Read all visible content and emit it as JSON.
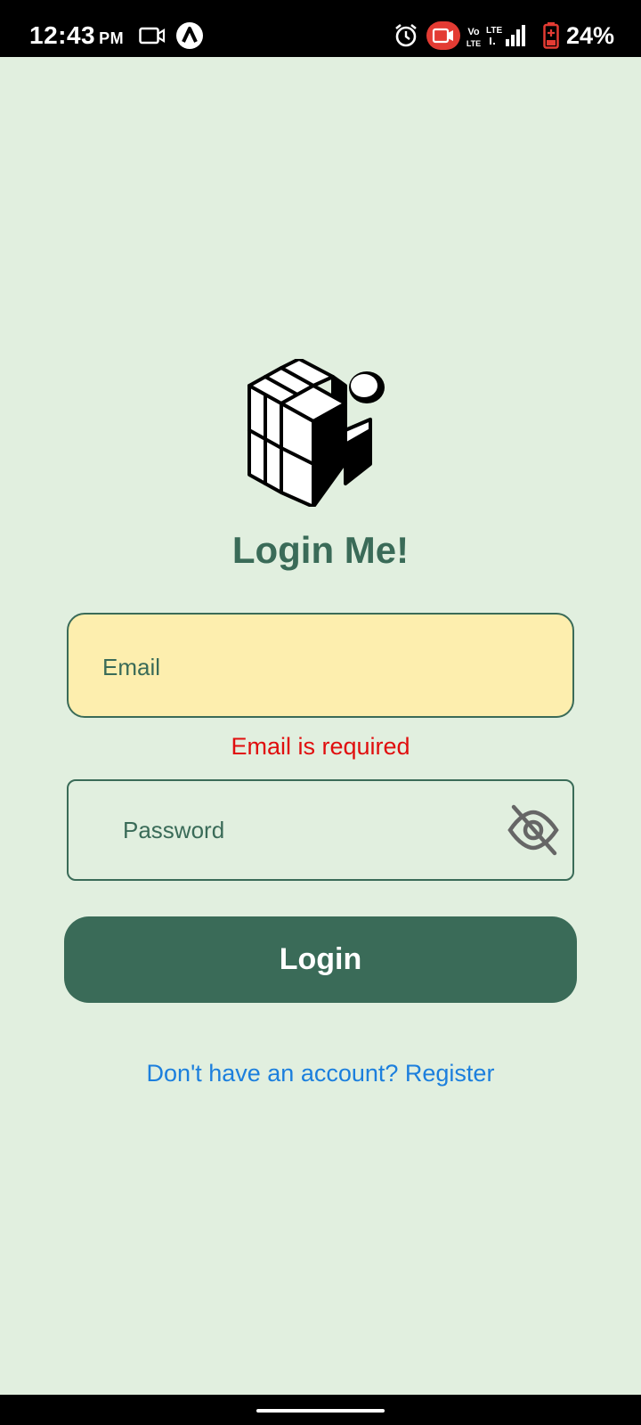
{
  "status_bar": {
    "time": "12:43",
    "ampm": "PM",
    "battery": "24%",
    "signal_labels": {
      "volte_top": "Vo",
      "volte_bottom": "LTE",
      "lte": "LTE"
    },
    "icons": [
      "video-camera-icon",
      "app-a-icon",
      "alarm-clock-icon",
      "screen-record-icon",
      "volte-icon",
      "lte-signal-icon",
      "battery-icon"
    ],
    "colors": {
      "background": "#000000",
      "record_badge": "#e33b33",
      "battery_low": "#e33b33"
    }
  },
  "app": {
    "title": "Login Me!",
    "logo_icon": "cubes-logo-icon"
  },
  "form": {
    "email_placeholder": "Email",
    "email_error": "Email is required",
    "password_placeholder": "Password",
    "password_toggle_icon": "eye-off-icon",
    "login_label": "Login",
    "register_prompt": "Don't have an account? Register"
  },
  "colors": {
    "page_background": "#e1efdf",
    "accent": "#3a6b58",
    "email_field_fill": "#fdeeae",
    "error": "#e00e0e",
    "link": "#1c7fdd"
  }
}
